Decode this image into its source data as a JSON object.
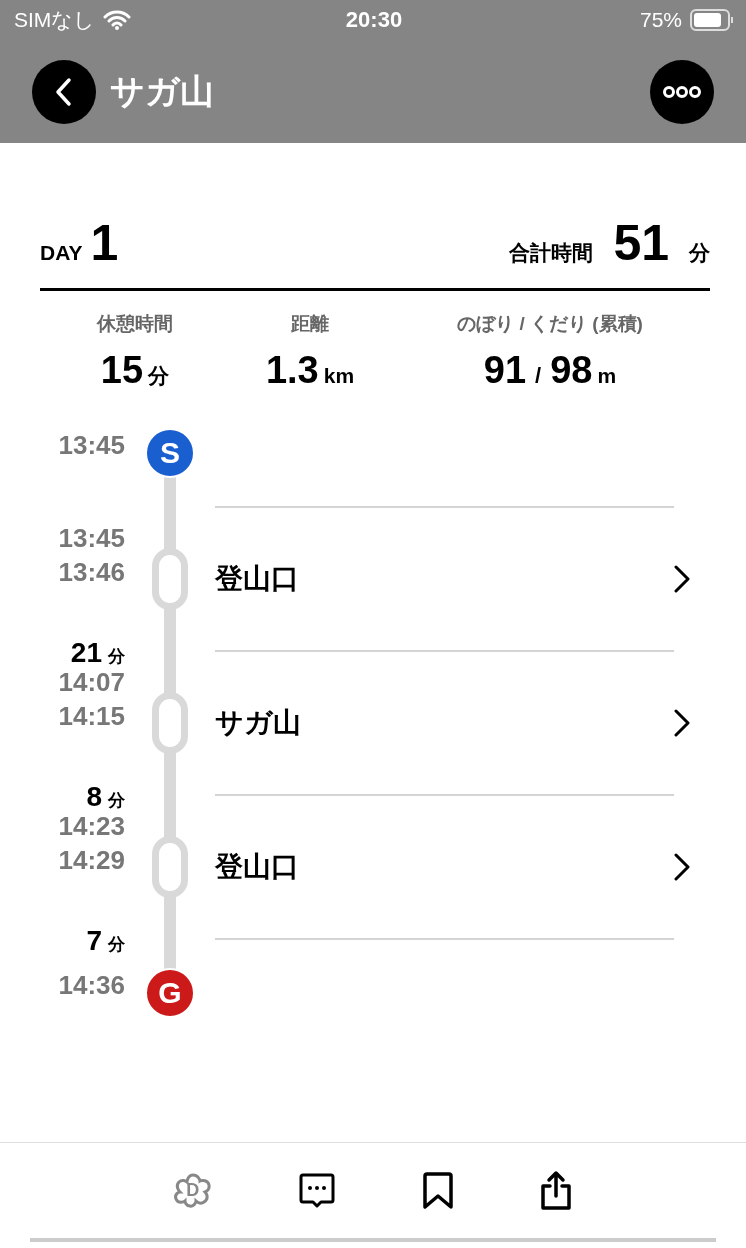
{
  "status_bar": {
    "carrier": "SIMなし",
    "time": "20:30",
    "battery": "75%"
  },
  "nav": {
    "title": "サガ山"
  },
  "summary": {
    "day_label": "DAY",
    "day": "1",
    "total_label": "合計時間",
    "total": "51",
    "total_unit": "分"
  },
  "stats": [
    {
      "label": "休憩時間",
      "parts": [
        {
          "kind": "num",
          "text": "15"
        },
        {
          "kind": "unit",
          "text": "分"
        }
      ]
    },
    {
      "label": "距離",
      "parts": [
        {
          "kind": "num",
          "text": "1.3"
        },
        {
          "kind": "unit",
          "text": "km"
        }
      ]
    },
    {
      "label": "のぼり / くだり (累積)",
      "parts": [
        {
          "kind": "num",
          "text": "91"
        },
        {
          "kind": "sep",
          "text": "/"
        },
        {
          "kind": "num",
          "text": "98"
        },
        {
          "kind": "unit",
          "text": "m"
        }
      ]
    }
  ],
  "timeline": {
    "start": {
      "time": "13:45",
      "badge": "S",
      "color": "#1a5fd0"
    },
    "stops": [
      {
        "arrive": "13:45",
        "depart": "13:46",
        "name": "登山口",
        "duration": "21",
        "duration_unit": "分"
      },
      {
        "arrive": "14:07",
        "depart": "14:15",
        "name": "サガ山",
        "duration": "8",
        "duration_unit": "分"
      },
      {
        "arrive": "14:23",
        "depart": "14:29",
        "name": "登山口",
        "duration": "7",
        "duration_unit": "分"
      }
    ],
    "goal": {
      "time": "14:36",
      "badge": "G",
      "color": "#cc1a1a"
    }
  },
  "toolbar": {
    "logo_letter": "D"
  }
}
